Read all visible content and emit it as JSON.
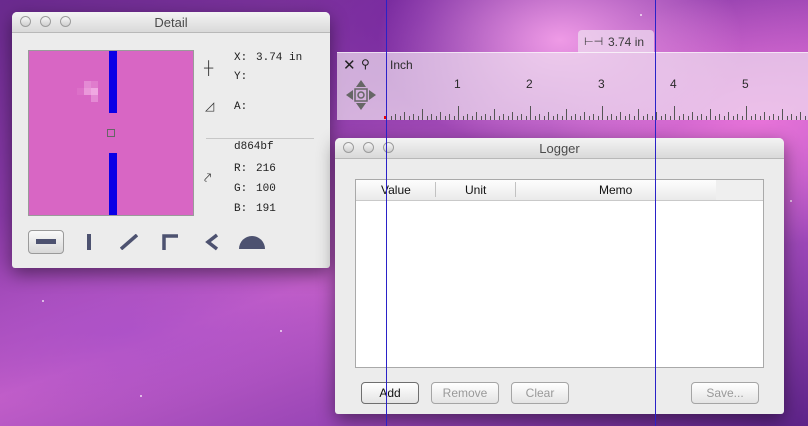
{
  "detail": {
    "title": "Detail",
    "x_label": "X:",
    "x_value": "3.74 in",
    "y_label": "Y:",
    "angle_label": "A:",
    "hex": "d864bf",
    "r_label": "R:",
    "r_value": "216",
    "g_label": "G:",
    "g_value": "100",
    "b_label": "B:",
    "b_value": "191",
    "color": "#d864bf",
    "tools": [
      "horizontal-line",
      "vertical-line",
      "diagonal-line",
      "corner-angle",
      "arrow-angle",
      "protractor"
    ]
  },
  "ruler": {
    "unit": "Inch",
    "measure": "3.74 in",
    "numbers": [
      "1",
      "2",
      "3",
      "4",
      "5"
    ]
  },
  "logger": {
    "title": "Logger",
    "columns": [
      "Value",
      "Unit",
      "Memo"
    ],
    "buttons": {
      "add": "Add",
      "remove": "Remove",
      "clear": "Clear",
      "save": "Save..."
    }
  }
}
